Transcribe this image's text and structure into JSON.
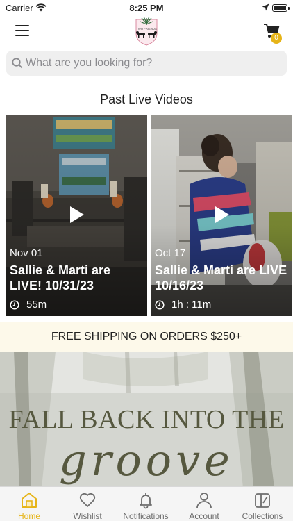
{
  "status_bar": {
    "carrier": "Carrier",
    "time": "8:25 PM"
  },
  "header": {
    "cart_count": "0",
    "logo_text": "TWO FRIENDS"
  },
  "search": {
    "placeholder": "What are you looking for?"
  },
  "past_live": {
    "title": "Past Live Videos",
    "videos": [
      {
        "date": "Nov 01",
        "title": "Sallie & Marti are LIVE! 10/31/23",
        "duration": "55m"
      },
      {
        "date": "Oct 17",
        "title": "Sallie & Marti are LIVE 10/16/23",
        "duration": "1h : 11m"
      }
    ]
  },
  "shipping_banner": "FREE SHIPPING ON ORDERS $250+",
  "hero": {
    "heading": "FALL BACK INTO THE",
    "script": "groove"
  },
  "tabbar": {
    "items": [
      {
        "label": "Home",
        "icon": "home-icon",
        "active": true
      },
      {
        "label": "Wishlist",
        "icon": "heart-icon",
        "active": false
      },
      {
        "label": "Notifications",
        "icon": "bell-icon",
        "active": false
      },
      {
        "label": "Account",
        "icon": "person-icon",
        "active": false
      },
      {
        "label": "Collections",
        "icon": "collections-icon",
        "active": false
      }
    ]
  },
  "colors": {
    "accent": "#e6b418",
    "shipping_bg": "#fdf9ea",
    "search_bg": "#efefef"
  }
}
